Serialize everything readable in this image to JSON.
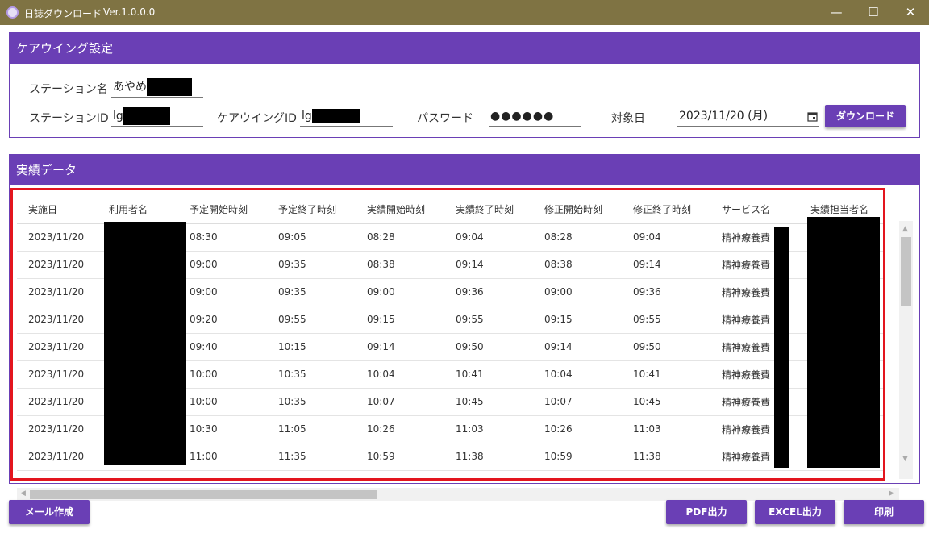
{
  "window": {
    "title": "日誌ダウンロード",
    "version": "Ver.1.0.0.0",
    "controls": {
      "minimize": "—",
      "maximize": "☐",
      "close": "✕"
    }
  },
  "settings": {
    "header": "ケアウイング設定",
    "station_name_label": "ステーション名",
    "station_name_value": "あやめ",
    "station_id_label": "ステーションID",
    "station_id_value": "lg",
    "carewing_id_label": "ケアウイングID",
    "carewing_id_value": "lg",
    "password_label": "パスワード",
    "password_value": "●●●●●●",
    "target_date_label": "対象日",
    "target_date_value": "2023/11/20 (月)",
    "download_button": "ダウンロード"
  },
  "results": {
    "header": "実績データ",
    "columns": [
      "実施日",
      "利用者名",
      "予定開始時刻",
      "予定終了時刻",
      "実績開始時刻",
      "実績終了時刻",
      "修正開始時刻",
      "修正終了時刻",
      "サービス名",
      "実績担当者名"
    ],
    "rows": [
      [
        "2023/11/20",
        "",
        "08:30",
        "09:05",
        "08:28",
        "09:04",
        "08:28",
        "09:04",
        "精神療養費",
        ""
      ],
      [
        "2023/11/20",
        "",
        "09:00",
        "09:35",
        "08:38",
        "09:14",
        "08:38",
        "09:14",
        "精神療養費",
        ""
      ],
      [
        "2023/11/20",
        "",
        "09:00",
        "09:35",
        "09:00",
        "09:36",
        "09:00",
        "09:36",
        "精神療養費",
        ""
      ],
      [
        "2023/11/20",
        "",
        "09:20",
        "09:55",
        "09:15",
        "09:55",
        "09:15",
        "09:55",
        "精神療養費",
        ""
      ],
      [
        "2023/11/20",
        "",
        "09:40",
        "10:15",
        "09:14",
        "09:50",
        "09:14",
        "09:50",
        "精神療養費",
        ""
      ],
      [
        "2023/11/20",
        "",
        "10:00",
        "10:35",
        "10:04",
        "10:41",
        "10:04",
        "10:41",
        "精神療養費",
        ""
      ],
      [
        "2023/11/20",
        "",
        "10:00",
        "10:35",
        "10:07",
        "10:45",
        "10:07",
        "10:45",
        "精神療養費",
        ""
      ],
      [
        "2023/11/20",
        "",
        "10:30",
        "11:05",
        "10:26",
        "11:03",
        "10:26",
        "11:03",
        "精神療養費",
        ""
      ],
      [
        "2023/11/20",
        "",
        "11:00",
        "11:35",
        "10:59",
        "11:38",
        "10:59",
        "11:38",
        "精神療養費",
        ""
      ]
    ]
  },
  "footer": {
    "mail_button": "メール作成",
    "pdf_button": "PDF出力",
    "excel_button": "EXCEL出力",
    "print_button": "印刷"
  },
  "colors": {
    "accent": "#6a3fb5",
    "titlebar": "#7f7343",
    "highlight": "#e3151e"
  }
}
